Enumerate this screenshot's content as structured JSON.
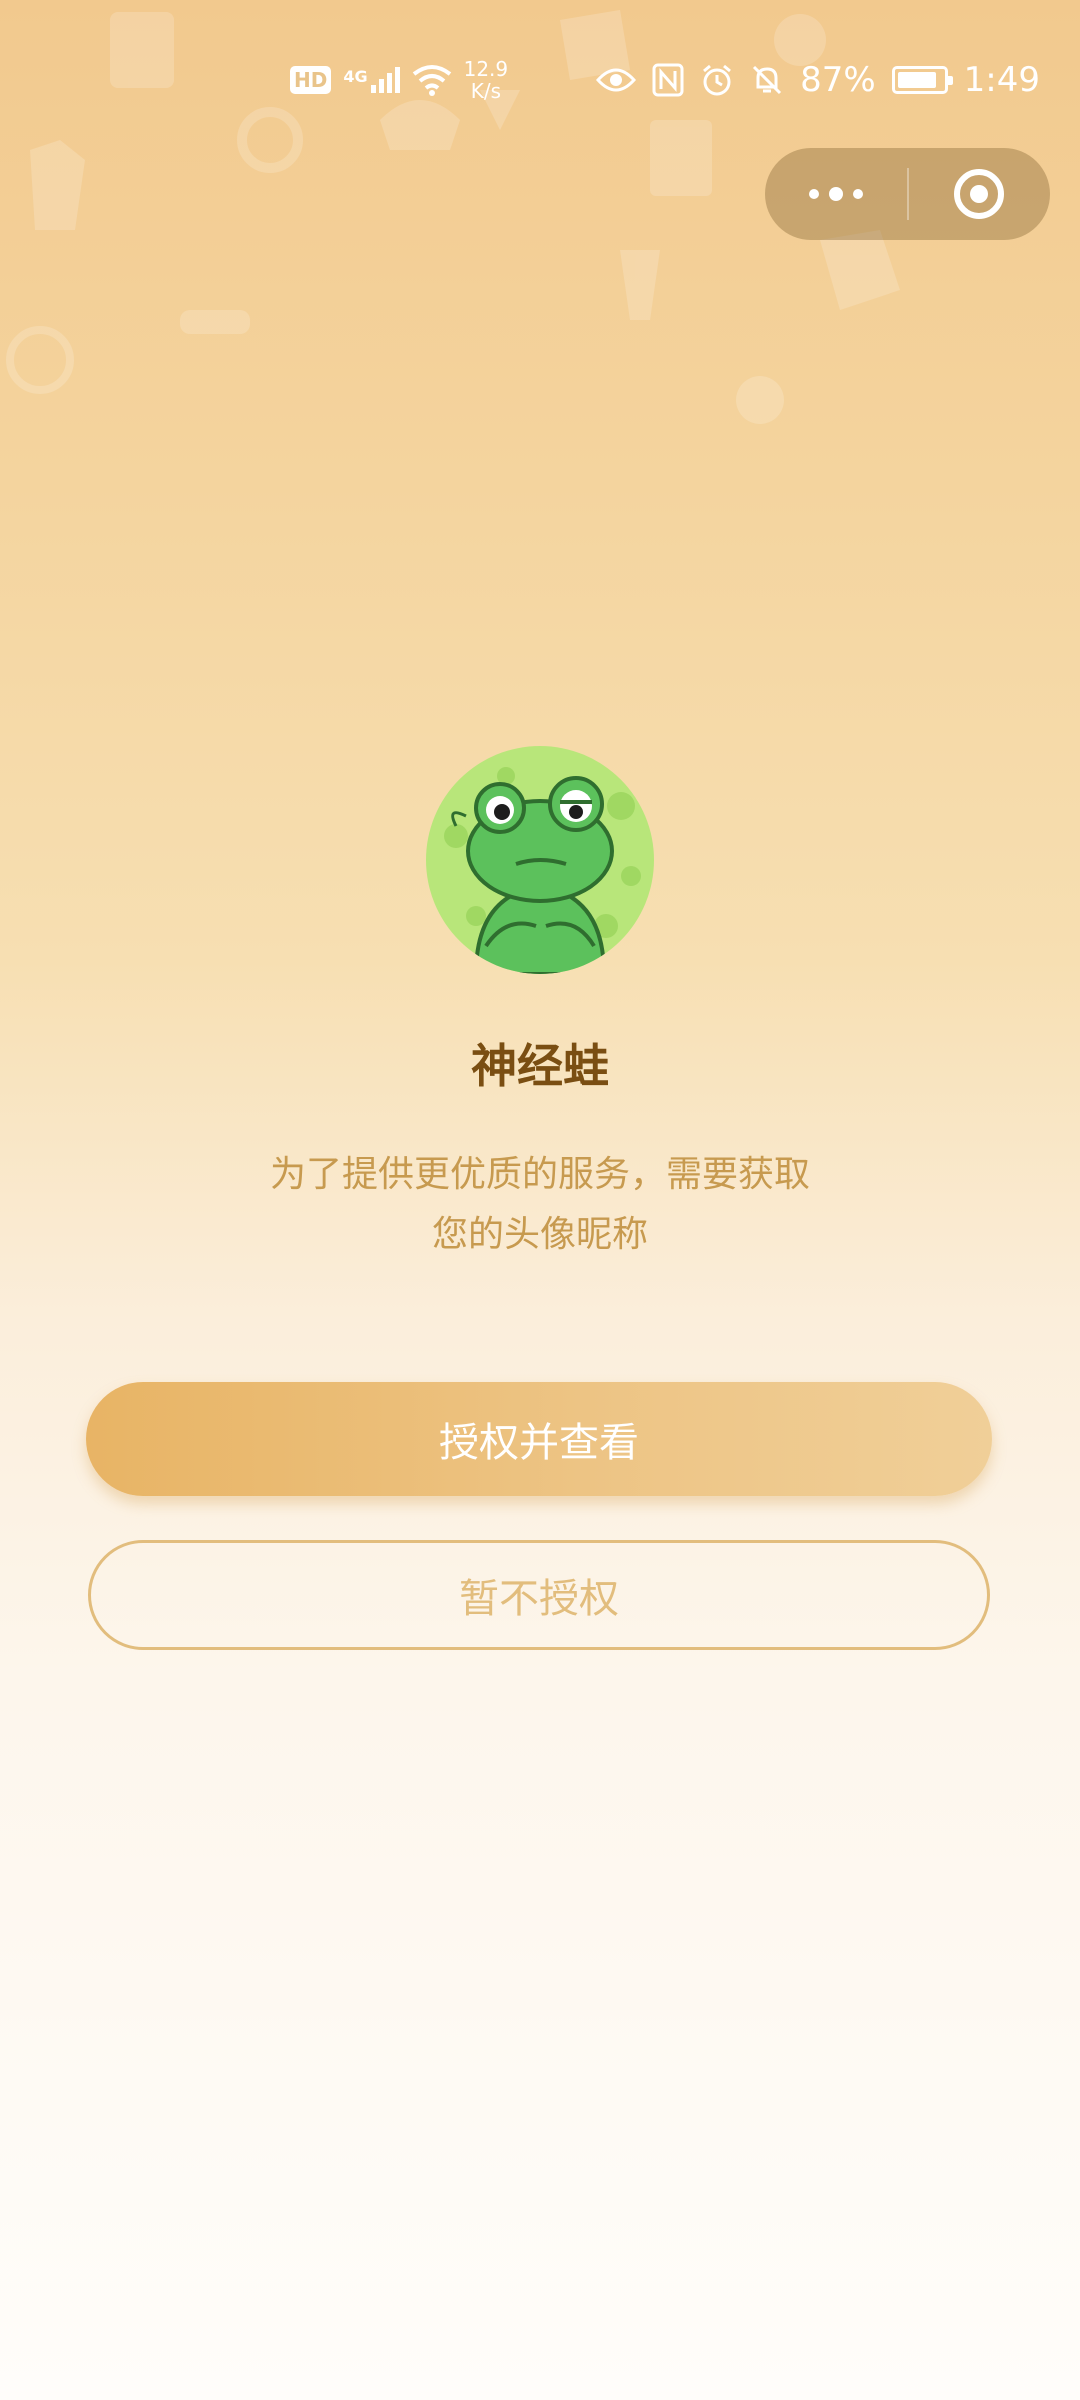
{
  "status_bar": {
    "hd": "HD",
    "network": "4G",
    "speed_value": "12.9",
    "speed_unit": "K/s",
    "battery": "87%",
    "battery_level": 0.87,
    "time": "1:49"
  },
  "capsule": {
    "more_icon": "more-dots-icon",
    "close_icon": "target-icon"
  },
  "profile": {
    "name": "神经蛙",
    "description": "为了提供更优质的服务，需要获取您的头像昵称"
  },
  "actions": {
    "authorize_label": "授权并查看",
    "decline_label": "暂不授权"
  },
  "colors": {
    "primary_button": "#e8b465",
    "title": "#7a4e12",
    "desc": "#c79a4f",
    "outline": "#e2bd7d"
  }
}
